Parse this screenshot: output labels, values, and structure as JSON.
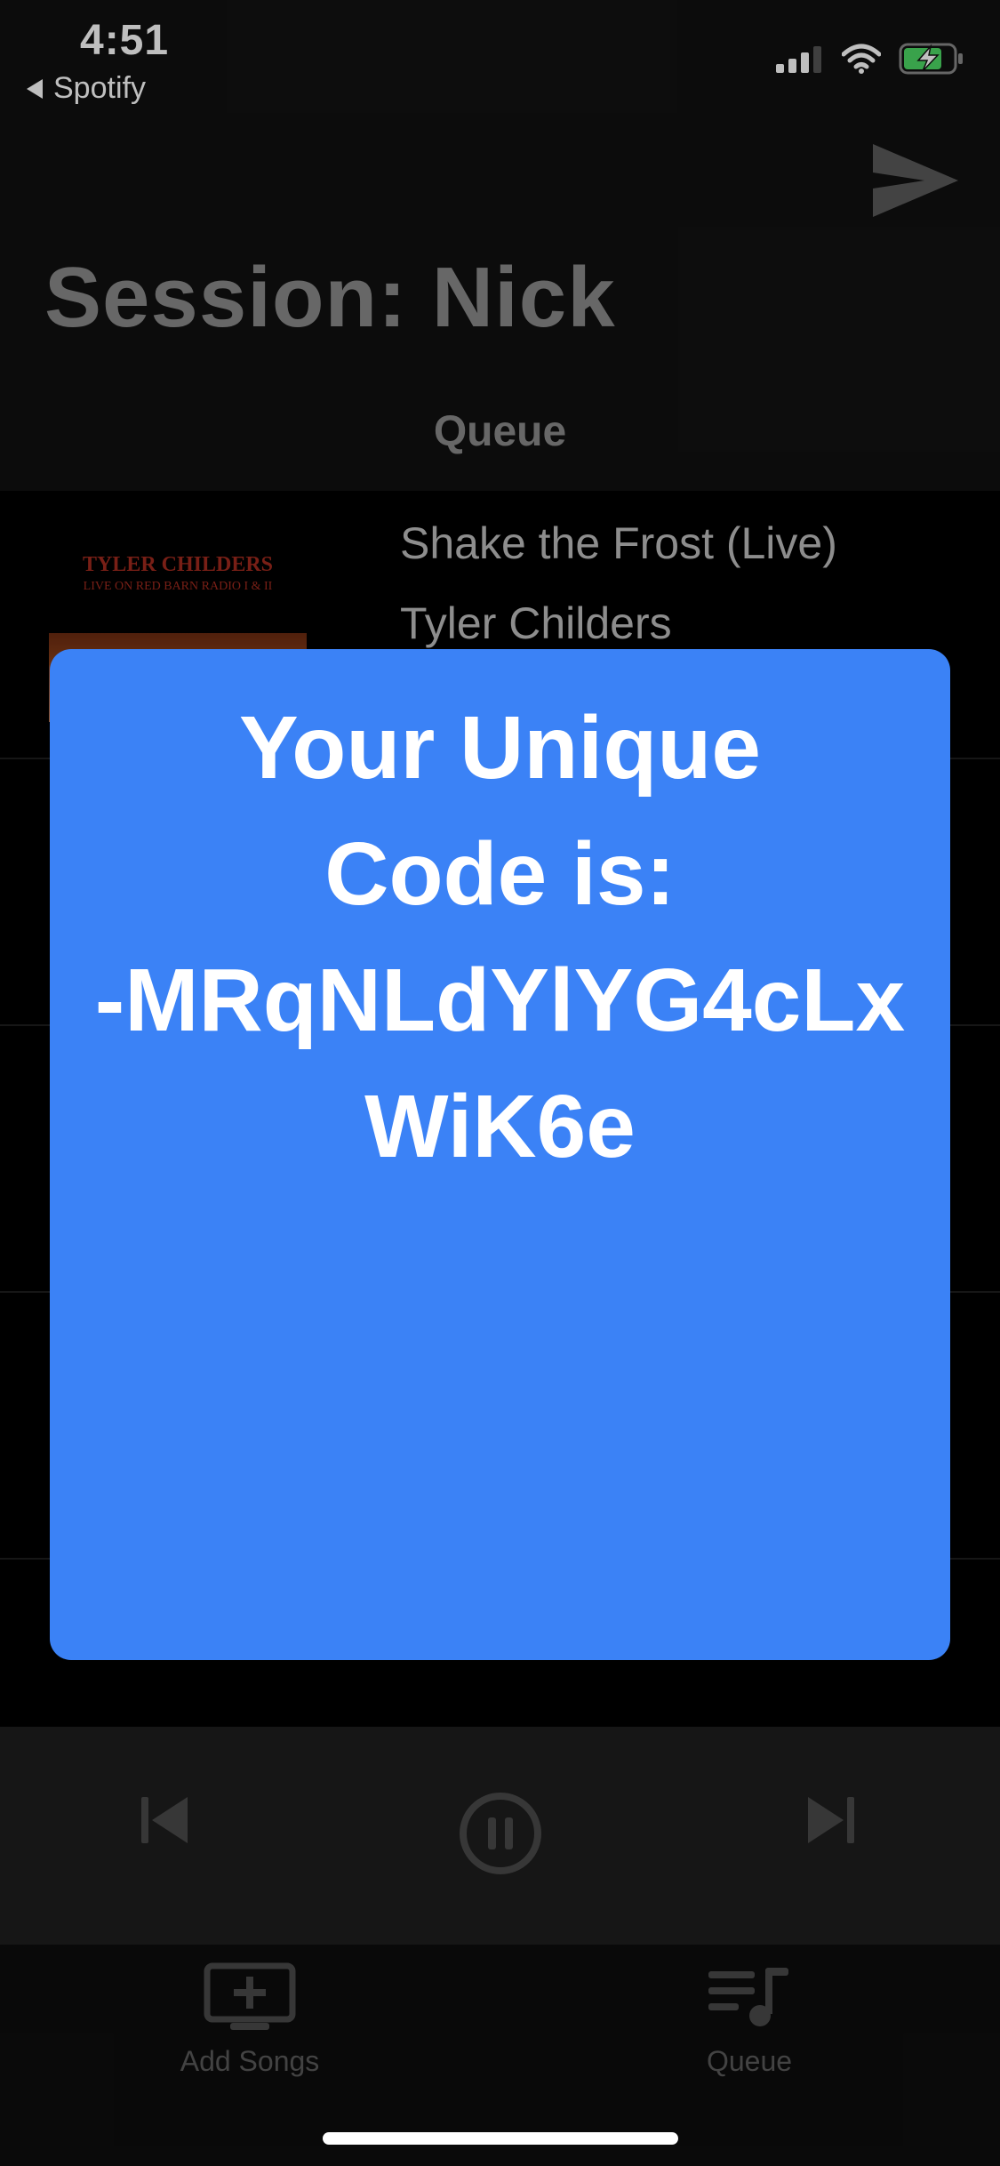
{
  "status_bar": {
    "time": "4:51",
    "back_app": "Spotify",
    "icons": [
      "cellular-signal-icon",
      "wifi-icon",
      "battery-charging-icon"
    ]
  },
  "header": {
    "title": "Session: Nick",
    "send_icon": "send-icon",
    "queue_heading": "Queue"
  },
  "queue": {
    "items": [
      {
        "title": "Shake the Frost (Live)",
        "artist": "Tyler Childers",
        "album_art_text": "TYLER CHILDERS",
        "album_art_subtext": "LIVE ON RED BARN RADIO I & II"
      }
    ]
  },
  "modal": {
    "line1": "Your Unique",
    "line2": "Code is:",
    "line3": "-MRqNLdYlYG4cLx",
    "line4": "WiK6e",
    "color": "#3b82f6"
  },
  "player": {
    "controls": [
      "skip-previous-icon",
      "pause-icon",
      "skip-next-icon"
    ]
  },
  "tabbar": {
    "tabs": [
      {
        "label": "Add Songs",
        "icon": "add-songs-icon"
      },
      {
        "label": "Queue",
        "icon": "queue-music-icon"
      }
    ]
  }
}
